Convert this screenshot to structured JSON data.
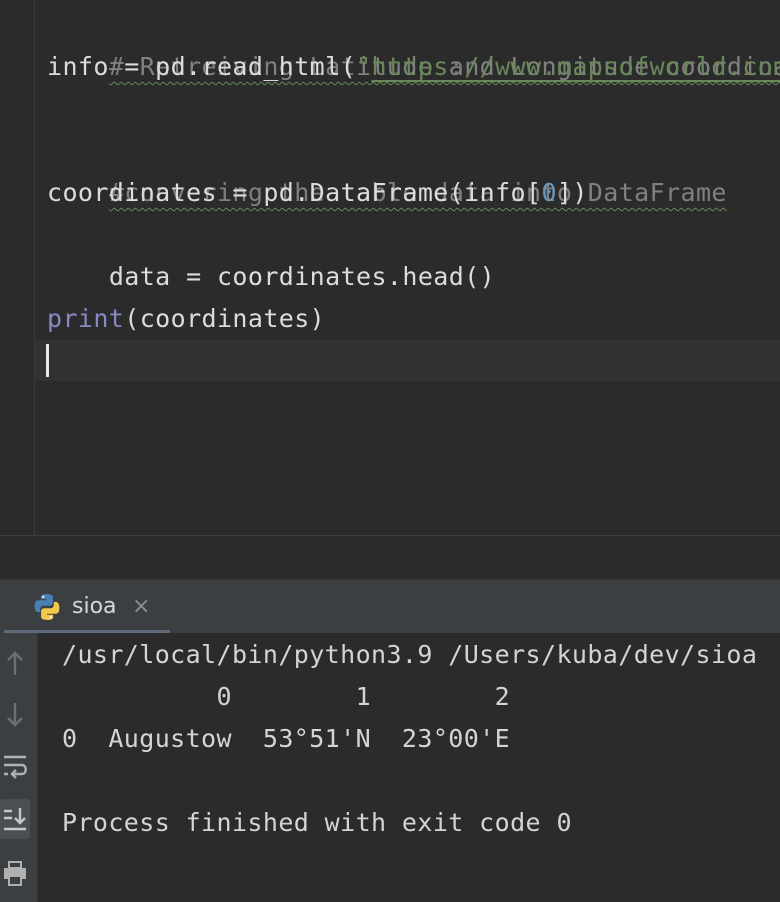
{
  "editor": {
    "lines": {
      "comment1": "# Retreiving Latitude and Longitude coordinates",
      "l2_prefix": "info = pd.read_html(",
      "l2_quote": "\"",
      "l2_url": "https://www.mapsofworld.com",
      "comment2": "#convering the table data into DataFrame",
      "l5_prefix": "coordinates = pd.DataFrame(info[",
      "l5_index": "0",
      "l5_suffix": "])",
      "l6": "data = coordinates.head()",
      "l8_builtin": "print",
      "l8_rest": "(coordinates)"
    }
  },
  "run_panel": {
    "tab_label": "sioa",
    "tab_close": "×",
    "icons": {
      "tab_icon": "python-icon",
      "up": "arrow-up-icon",
      "down": "arrow-down-icon",
      "wrap": "soft-wrap-icon",
      "scroll": "scroll-to-end-icon",
      "print": "print-icon"
    }
  },
  "console": {
    "lines": [
      "/usr/local/bin/python3.9 /Users/kuba/dev/sioa",
      "          0        1        2",
      "0  Augustow  53°51'N  23°00'E",
      "",
      "Process finished with exit code 0"
    ]
  },
  "colors": {
    "background": "#2b2b2b",
    "comment": "#808080",
    "string": "#6a8759",
    "number": "#6897bb",
    "builtin": "#8888c6",
    "text": "#dcdcdc"
  }
}
